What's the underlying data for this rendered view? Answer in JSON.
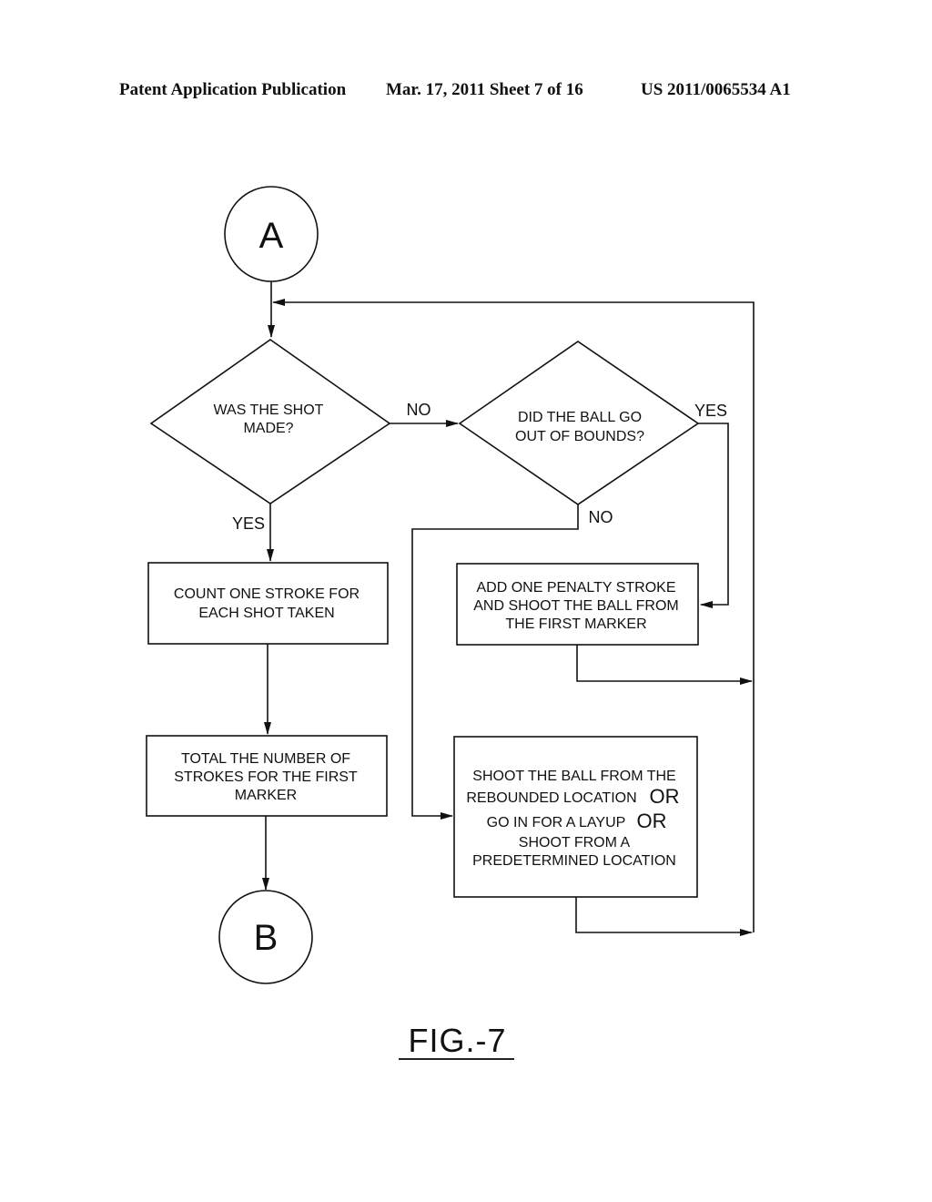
{
  "header": {
    "left": "Patent Application Publication",
    "center": "Mar. 17, 2011  Sheet 7 of 16",
    "right": "US 2011/0065534 A1"
  },
  "flowchart": {
    "connector_start": "A",
    "connector_end": "B",
    "decision_shot_made": [
      "WAS THE SHOT",
      "MADE?"
    ],
    "decision_out_of_bounds": [
      "DID THE BALL GO",
      "OUT OF BOUNDS?"
    ],
    "box_count_strokes": [
      "COUNT ONE STROKE FOR",
      "EACH SHOT TAKEN"
    ],
    "box_total_strokes": [
      "TOTAL THE NUMBER OF",
      "STROKES FOR THE FIRST",
      "MARKER"
    ],
    "box_penalty": [
      "ADD ONE PENALTY STROKE",
      "AND SHOOT THE BALL FROM",
      "THE FIRST MARKER"
    ],
    "box_rebound": {
      "line1": "SHOOT THE BALL FROM THE",
      "line2": "REBOUNDED LOCATION",
      "line3": "GO IN FOR A LAYUP",
      "line4": "SHOOT FROM A",
      "line5": "PREDETERMINED LOCATION",
      "or_word": "OR"
    },
    "edge_labels": {
      "shot_made_no": "NO",
      "shot_made_yes": "YES",
      "out_of_bounds_yes": "YES",
      "out_of_bounds_no": "NO"
    }
  },
  "figure_label": "FIG.-7"
}
